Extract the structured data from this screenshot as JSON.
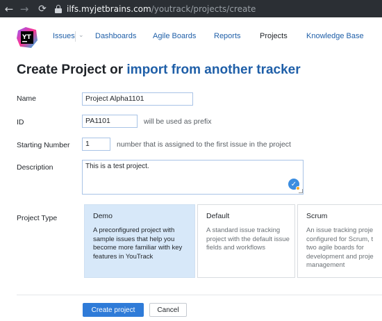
{
  "browser": {
    "url_host": "ilfs.myjetbrains.com",
    "url_path": "/youtrack/projects/create",
    "icons": [
      "back-arrow-icon",
      "forward-arrow-icon",
      "reload-icon",
      "lock-icon"
    ]
  },
  "app": {
    "logo_text": "YT",
    "nav": [
      {
        "label": "Issues",
        "active": false
      },
      {
        "label": "Dashboards",
        "active": false
      },
      {
        "label": "Agile Boards",
        "active": false
      },
      {
        "label": "Reports",
        "active": false
      },
      {
        "label": "Projects",
        "active": true
      },
      {
        "label": "Knowledge Base",
        "active": false
      }
    ]
  },
  "page": {
    "title_plain": "Create Project or ",
    "title_link": "import from another tracker"
  },
  "form": {
    "name_label": "Name",
    "name_value": "Project Alpha1101",
    "id_label": "ID",
    "id_value": "PA1101",
    "id_hint": "will be used as prefix",
    "start_label": "Starting Number",
    "start_value": "1",
    "start_hint": "number that is assigned to the first issue in the project",
    "desc_label": "Description",
    "desc_value": "This is a test project.",
    "type_label": "Project Type"
  },
  "project_types": [
    {
      "title": "Demo",
      "selected": true,
      "lines": [
        "A preconfigured project with",
        "sample issues that help you",
        "become more familiar with key",
        "features in YouTrack"
      ]
    },
    {
      "title": "Default",
      "selected": false,
      "lines": [
        "A standard issue tracking",
        "project with the default issue",
        "fields and workflows"
      ]
    },
    {
      "title": "Scrum",
      "selected": false,
      "lines": [
        "An issue tracking proje",
        "configured for Scrum, t",
        "two agile boards for",
        "development and proje",
        "management"
      ]
    }
  ],
  "actions": {
    "create_label": "Create project",
    "cancel_label": "Cancel"
  },
  "colors": {
    "accent": "#2f7bd8",
    "link": "#1f5fa8",
    "selected_card": "#d7e8f9"
  }
}
